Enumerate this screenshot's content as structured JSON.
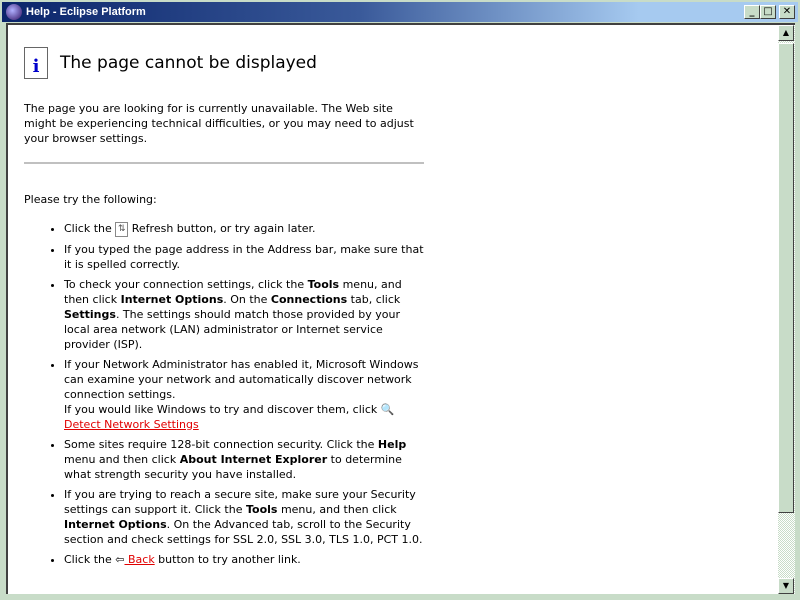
{
  "window": {
    "title": "Help - Eclipse Platform"
  },
  "page": {
    "heading": "The page cannot be displayed",
    "intro": "The page you are looking for is currently unavailable. The Web site might be experiencing technical difficulties, or you may need to adjust your browser settings.",
    "try_label": "Please try the following:",
    "items": {
      "refresh_a": "Click the",
      "refresh_b": " Refresh button, or try again later.",
      "address": "If you typed the page address in the Address bar, make sure that it is spelled correctly.",
      "conn_1": "To check your connection settings, click the ",
      "conn_tools": "Tools",
      "conn_2": " menu, and then click ",
      "conn_io": "Internet Options",
      "conn_3": ". On the ",
      "conn_tab": "Connections",
      "conn_4": " tab, click ",
      "conn_settings": "Settings",
      "conn_5": ". The settings should match those provided by your local area network (LAN) administrator or Internet service provider (ISP).",
      "net_1": "If your Network Administrator has enabled it, Microsoft Windows can examine your network and automatically discover network connection settings.",
      "net_2": "If you would like Windows to try and discover them, click",
      "net_link": " Detect Network Settings",
      "sec_1": "Some sites require 128-bit connection security. Click the ",
      "sec_help": "Help",
      "sec_2": " menu and then click ",
      "sec_about": "About Internet Explorer",
      "sec_3": " to determine what strength security you have installed.",
      "ssl_1": "If you are trying to reach a secure site, make sure your Security settings can support it. Click the ",
      "ssl_tools": "Tools",
      "ssl_2": " menu, and then click ",
      "ssl_io": "Internet Options",
      "ssl_3": ". On the Advanced tab, scroll to the Security section and check settings for SSL 2.0, SSL 3.0, TLS 1.0, PCT 1.0.",
      "back_a": "Click the ",
      "back_link": " Back",
      "back_b": " button to try another link."
    }
  }
}
